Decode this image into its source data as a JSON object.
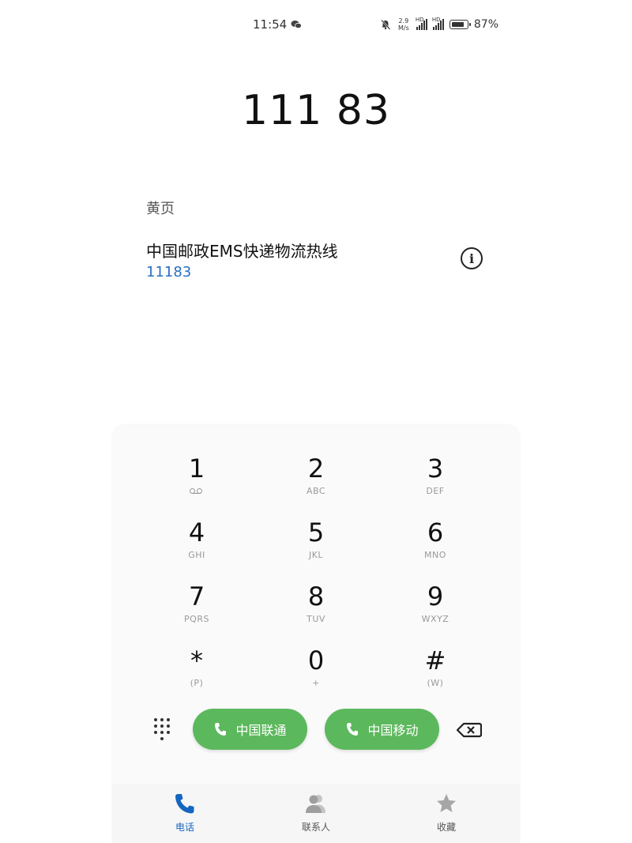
{
  "status_bar": {
    "time": "11:54",
    "net_speed_value": "2.9",
    "net_speed_unit": "M/s",
    "signal_label_1": "HD",
    "signal_label_2": "HD",
    "battery": "87%",
    "battery_level_percent": 87
  },
  "dialer": {
    "dialed_number": "111 83"
  },
  "result": {
    "section_label": "黄页",
    "contact_name": "中国邮政EMS快递物流热线",
    "contact_number": "11183"
  },
  "keypad": {
    "keys": [
      {
        "digit": "1",
        "letters": ""
      },
      {
        "digit": "2",
        "letters": "ABC"
      },
      {
        "digit": "3",
        "letters": "DEF"
      },
      {
        "digit": "4",
        "letters": "GHI"
      },
      {
        "digit": "5",
        "letters": "JKL"
      },
      {
        "digit": "6",
        "letters": "MNO"
      },
      {
        "digit": "7",
        "letters": "PQRS"
      },
      {
        "digit": "8",
        "letters": "TUV"
      },
      {
        "digit": "9",
        "letters": "WXYZ"
      },
      {
        "digit": "*",
        "letters": "(P)"
      },
      {
        "digit": "0",
        "letters": "+"
      },
      {
        "digit": "#",
        "letters": "(W)"
      }
    ]
  },
  "actions": {
    "call_sim1_label": "中国联通",
    "call_sim2_label": "中国移动",
    "call_button_color": "#5cb85c"
  },
  "nav": {
    "items": [
      {
        "label": "电话",
        "icon": "phone-icon",
        "active": true
      },
      {
        "label": "联系人",
        "icon": "contacts-icon",
        "active": false
      },
      {
        "label": "收藏",
        "icon": "star-icon",
        "active": false
      }
    ],
    "active_color": "#1565c0"
  }
}
